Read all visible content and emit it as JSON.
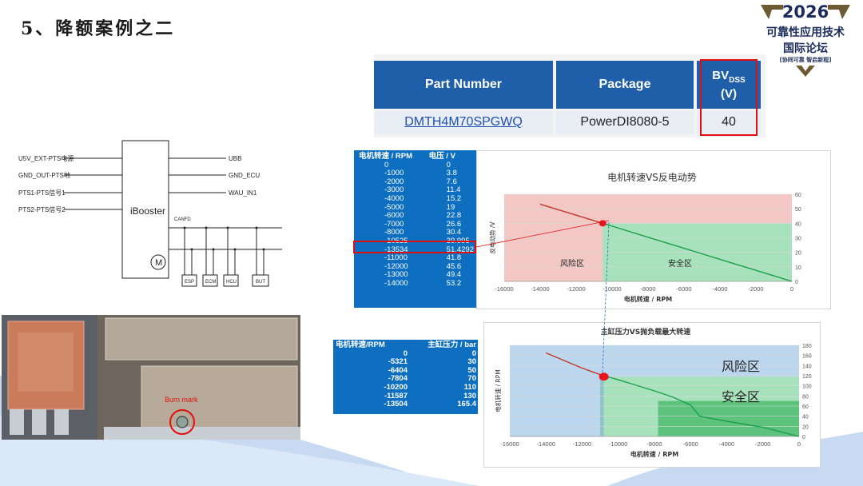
{
  "slide": {
    "title": "5、降额案例之二"
  },
  "logo": {
    "year": "2026",
    "line1": "可靠性应用技术",
    "line2": "国际论坛",
    "line3": "[协同可靠 智启新程]"
  },
  "part_table": {
    "headers": [
      "Part Number",
      "Package",
      "BV",
      "DSS",
      "(V)"
    ],
    "part_number": "DMTH4M70SPGWQ",
    "package": "PowerDI8080-5",
    "bvdss": "40"
  },
  "schematic": {
    "left_pins": [
      "U5V_EXT-PTS电源",
      "GND_OUT-PTS地",
      "PTS1-PTS信号1",
      "PTS2-PTS信号2"
    ],
    "right_pins": [
      "UBB",
      "GND_ECU",
      "WAU_IN1"
    ],
    "block_label": "iBooster",
    "bus_label": "CANFD",
    "motor_label": "M",
    "nodes": [
      "ESP",
      "ECM",
      "HCU",
      "BUT"
    ]
  },
  "photo": {
    "annotation": "Burn mark"
  },
  "table1": {
    "headers": [
      "电机转速 / RPM",
      "电压 / V"
    ],
    "rows": [
      [
        "0",
        "0"
      ],
      [
        "-1000",
        "3.8"
      ],
      [
        "-2000",
        "7.6"
      ],
      [
        "-3000",
        "11.4"
      ],
      [
        "-4000",
        "15.2"
      ],
      [
        "-5000",
        "19"
      ],
      [
        "-6000",
        "22.8"
      ],
      [
        "-7000",
        "26.6"
      ],
      [
        "-8000",
        "30.4"
      ],
      [
        "-10525",
        "39.995"
      ],
      [
        "-13534",
        "51.4292"
      ],
      [
        "-11000",
        "41.8"
      ],
      [
        "-12000",
        "45.6"
      ],
      [
        "-13000",
        "49.4"
      ],
      [
        "-14000",
        "53.2"
      ]
    ],
    "highlight_row": 9
  },
  "table2": {
    "headers": [
      "电机转速/RPM",
      "主缸压力 / bar"
    ],
    "rows": [
      [
        "0",
        "0"
      ],
      [
        "-5321",
        "30"
      ],
      [
        "-6404",
        "50"
      ],
      [
        "-7804",
        "70"
      ],
      [
        "-10200",
        "110"
      ],
      [
        "-11587",
        "130"
      ],
      [
        "-13504",
        "165.4"
      ]
    ]
  },
  "chart_data": [
    {
      "type": "line",
      "title": "电机转速VS反电动势",
      "xlabel": "电机转速  /  RPM",
      "ylabel": "反电动势  /V",
      "xlim": [
        -16000,
        0
      ],
      "ylim": [
        0,
        60
      ],
      "xticks": [
        "-16000",
        "-14000",
        "-12000",
        "-10000",
        "-8000",
        "-6000",
        "-4000",
        "-2000",
        "0"
      ],
      "yticks": [
        "0",
        "10",
        "20",
        "30",
        "40",
        "50",
        "60"
      ],
      "x": [
        0,
        -1000,
        -2000,
        -3000,
        -4000,
        -5000,
        -6000,
        -7000,
        -8000,
        -10525,
        -11000,
        -12000,
        -13000,
        -14000
      ],
      "y": [
        0,
        3.8,
        7.6,
        11.4,
        15.2,
        19,
        22.8,
        26.6,
        30.4,
        39.995,
        41.8,
        45.6,
        49.4,
        53.2
      ],
      "marker": {
        "x": -10525,
        "y": 40
      },
      "regions": [
        {
          "label": "风险区",
          "color": "#f2c7c4"
        },
        {
          "label": "安全区",
          "color": "#a8e2bc"
        }
      ],
      "colors": {
        "risk_line": "#c0392b",
        "safe_line": "#1aa04a",
        "marker": "#e8141e"
      },
      "grid": true
    },
    {
      "type": "line",
      "title": "主缸压力VS抛负载最大转速",
      "xlabel": "电机转速  /  RPM",
      "ylabel": "电机转速 / RPM",
      "xlim": [
        -16000,
        0
      ],
      "ylim": [
        0,
        180
      ],
      "xticks": [
        "-16000",
        "-14000",
        "-12000",
        "-10000",
        "-8000",
        "-6000",
        "-4000",
        "-2000",
        "0"
      ],
      "yticks": [
        "0",
        "20",
        "40",
        "60",
        "80",
        "100",
        "120",
        "140",
        "160",
        "180"
      ],
      "x": [
        -14000,
        -13000,
        -12000,
        -11000,
        -10600,
        -10000,
        -9000,
        -8000,
        -7000,
        -6000,
        -5500,
        -4000,
        -2000,
        0
      ],
      "y": [
        165,
        150,
        135,
        122,
        118,
        112,
        101,
        90,
        78,
        62,
        40,
        30,
        18,
        0
      ],
      "marker": {
        "x": -10800,
        "y": 118
      },
      "regions": [
        {
          "label": "风险区",
          "color": "#bcd6ee"
        },
        {
          "label": "安全区",
          "color": "#a8e2bc"
        }
      ],
      "colors": {
        "risk_line": "#c0392b",
        "safe_line": "#1aa04a",
        "marker": "#e8141e"
      },
      "grid": true
    }
  ]
}
